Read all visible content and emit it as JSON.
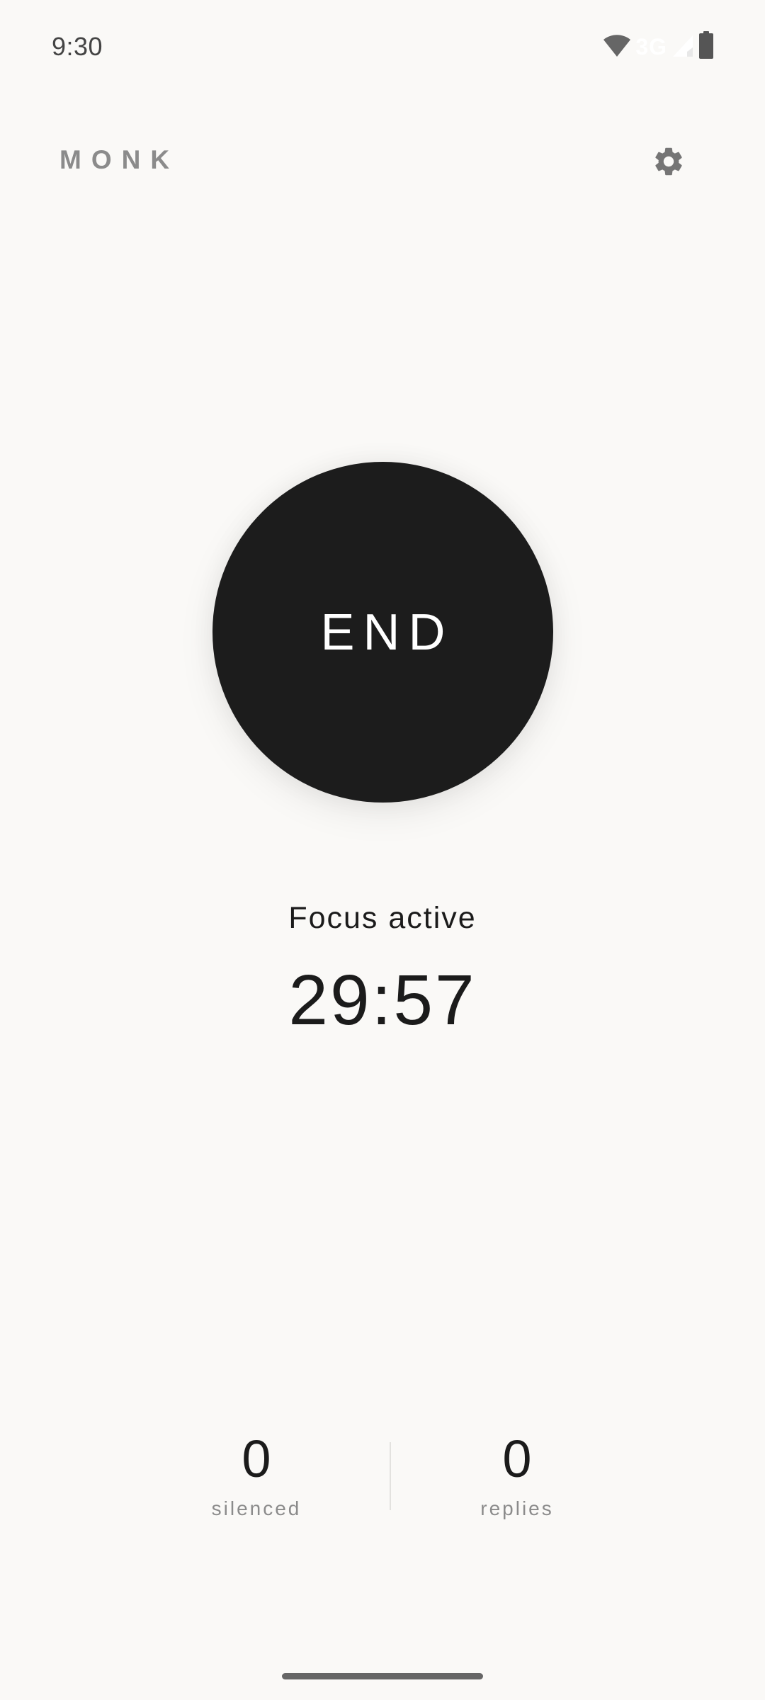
{
  "status_bar": {
    "time": "9:30",
    "network": "3G",
    "icons": [
      "wifi-icon",
      "signal-icon",
      "battery-icon"
    ]
  },
  "header": {
    "title": "MONK",
    "settings_icon": "gear-icon"
  },
  "session": {
    "button_label": "END",
    "status": "Focus active",
    "timer": "29:57"
  },
  "stats": {
    "silenced": {
      "value": "0",
      "label": "silenced"
    },
    "replies": {
      "value": "0",
      "label": "replies"
    }
  },
  "colors": {
    "background": "#faf9f7",
    "button": "#1c1c1c",
    "muted_text": "#8b8b8b",
    "primary_text": "#1b1b1b"
  }
}
